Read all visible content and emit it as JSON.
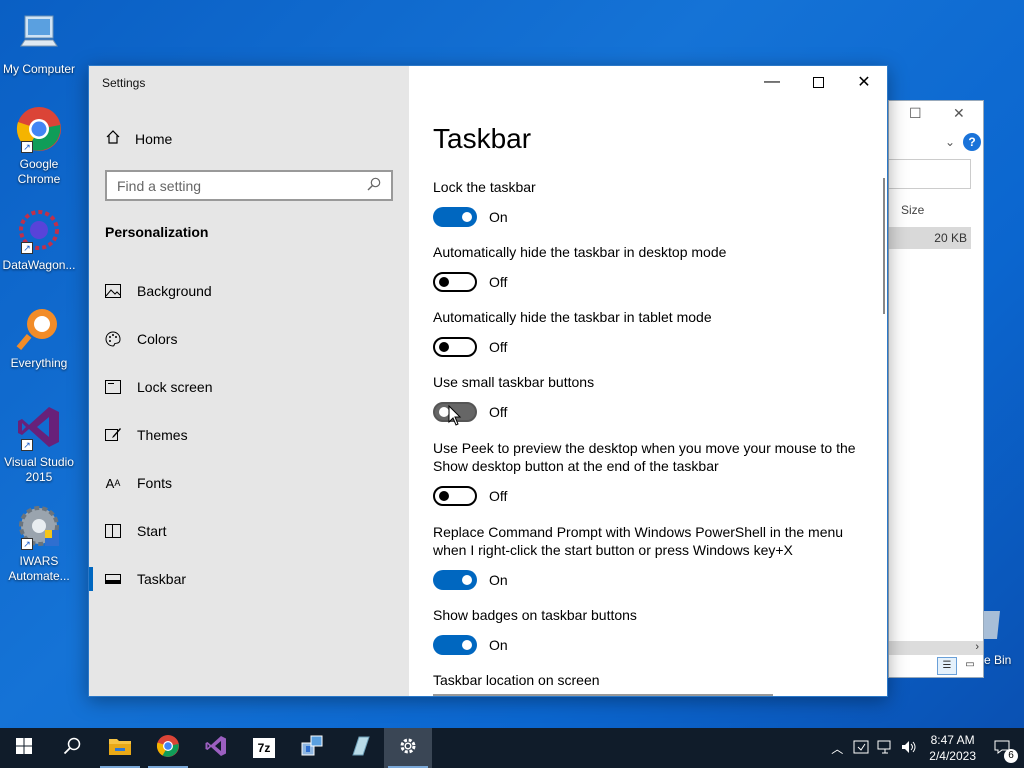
{
  "desktop": {
    "icons": [
      {
        "label": "My Computer",
        "icon": "computer-icon"
      },
      {
        "label": "Google Chrome",
        "icon": "chrome-icon"
      },
      {
        "label": "DataWagon...",
        "icon": "datawagon-icon"
      },
      {
        "label": "Everything",
        "icon": "everything-icon"
      },
      {
        "label": "Visual Studio 2015",
        "icon": "visual-studio-icon"
      },
      {
        "label": "IWARS Automate...",
        "icon": "iwars-icon"
      }
    ],
    "recycle_bin_partial": "e Bin"
  },
  "bg_window": {
    "size_header": "Size",
    "file_size": "20 KB"
  },
  "settings": {
    "window_title": "Settings",
    "home_label": "Home",
    "search_placeholder": "Find a setting",
    "section": "Personalization",
    "nav": [
      {
        "label": "Background",
        "icon": "image-icon"
      },
      {
        "label": "Colors",
        "icon": "palette-icon"
      },
      {
        "label": "Lock screen",
        "icon": "lock-screen-icon"
      },
      {
        "label": "Themes",
        "icon": "brush-icon"
      },
      {
        "label": "Fonts",
        "icon": "font-icon"
      },
      {
        "label": "Start",
        "icon": "start-icon"
      },
      {
        "label": "Taskbar",
        "icon": "taskbar-icon",
        "active": true
      }
    ],
    "page_title": "Taskbar",
    "options": [
      {
        "label": "Lock the taskbar",
        "state": "On"
      },
      {
        "label": "Automatically hide the taskbar in desktop mode",
        "state": "Off"
      },
      {
        "label": "Automatically hide the taskbar in tablet mode",
        "state": "Off"
      },
      {
        "label": "Use small taskbar buttons",
        "state": "Off"
      },
      {
        "label": "Use Peek to preview the desktop when you move your mouse to the Show desktop button at the end of the taskbar",
        "state": "Off"
      },
      {
        "label": "Replace Command Prompt with Windows PowerShell in the menu when I right-click the start button or press Windows key+X",
        "state": "On"
      },
      {
        "label": "Show badges on taskbar buttons",
        "state": "On"
      }
    ],
    "location_label": "Taskbar location on screen"
  },
  "taskbar": {
    "time": "8:47 AM",
    "date": "2/4/2023",
    "notification_count": "6"
  },
  "colors": {
    "accent": "#0067c0",
    "taskbar_bg": "#101c2a",
    "sidebar_bg": "#e6e6e6"
  }
}
